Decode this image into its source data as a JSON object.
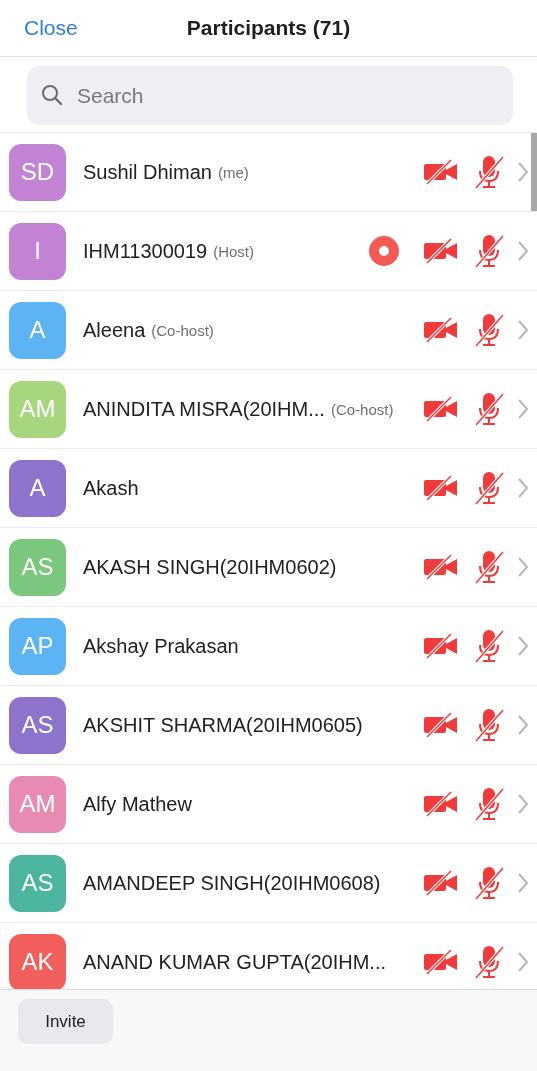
{
  "header": {
    "close": "Close",
    "title": "Participants (71)"
  },
  "search": {
    "placeholder": "Search"
  },
  "participants": [
    {
      "initials": "SD",
      "color": "#c383d4",
      "name": "Sushil Dhiman",
      "role": "(me)",
      "video_muted": true,
      "audio_muted": true
    },
    {
      "initials": "I",
      "color": "#c383d4",
      "name": "IHM11300019",
      "role": "(Host)",
      "recording": true,
      "video_muted": true,
      "audio_muted": true
    },
    {
      "initials": "A",
      "color": "#5db4f4",
      "name": "Aleena",
      "role": "(Co-host)",
      "video_muted": true,
      "audio_muted": true
    },
    {
      "initials": "AM",
      "color": "#a8d67e",
      "name": "ANINDITA MISRA(20IHM...",
      "role": "(Co-host)",
      "video_muted": true,
      "audio_muted": true
    },
    {
      "initials": "A",
      "color": "#8e73cc",
      "name": "Akash",
      "video_muted": true,
      "audio_muted": true
    },
    {
      "initials": "AS",
      "color": "#7bc77e",
      "name": "AKASH SINGH(20IHM0602)",
      "video_muted": true,
      "audio_muted": true
    },
    {
      "initials": "AP",
      "color": "#5db4f4",
      "name": "Akshay Prakasan",
      "video_muted": true,
      "audio_muted": true
    },
    {
      "initials": "AS",
      "color": "#8e73cc",
      "name": "AKSHIT SHARMA(20IHM0605)",
      "video_muted": true,
      "audio_muted": true
    },
    {
      "initials": "AM",
      "color": "#e78bb3",
      "name": "Alfy Mathew",
      "video_muted": true,
      "audio_muted": true
    },
    {
      "initials": "AS",
      "color": "#4bb59f",
      "name": "AMANDEEP SINGH(20IHM0608)",
      "video_muted": true,
      "audio_muted": true
    },
    {
      "initials": "AK",
      "color": "#f25e5b",
      "name": "ANAND KUMAR GUPTA(20IHM...",
      "video_muted": true,
      "audio_muted": true
    }
  ],
  "footer": {
    "invite": "Invite"
  }
}
